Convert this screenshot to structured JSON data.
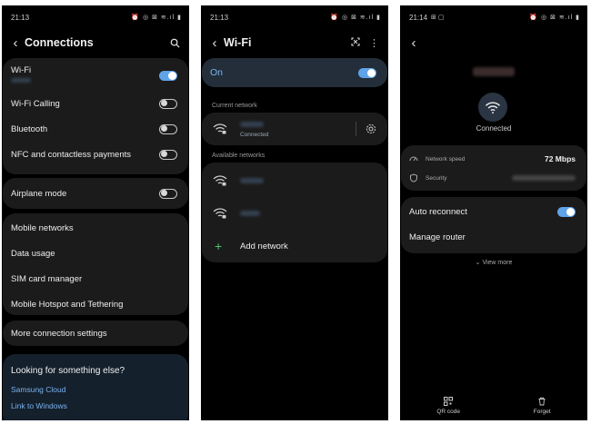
{
  "screen1": {
    "status": {
      "time": "21:13",
      "icons": "⏰ ◎ ⊠ ≋.ıl ▮"
    },
    "title": "Connections",
    "items": {
      "wifi": "Wi-Fi",
      "wifi_calling": "Wi-Fi Calling",
      "bluetooth": "Bluetooth",
      "nfc": "NFC and contactless payments",
      "airplane": "Airplane mode",
      "mobile_networks": "Mobile networks",
      "data_usage": "Data usage",
      "sim_manager": "SIM card manager",
      "hotspot": "Mobile Hotspot and Tethering",
      "more_settings": "More connection settings"
    },
    "suggest": {
      "heading": "Looking for something else?",
      "links": [
        "Samsung Cloud",
        "Link to Windows"
      ]
    },
    "toggles": {
      "wifi": true,
      "wifi_calling": false,
      "bluetooth": false,
      "nfc": false,
      "airplane": false
    }
  },
  "screen2": {
    "status": {
      "time": "21:13",
      "icons": "⏰ ◎ ⊠ ≋.ıl ▮"
    },
    "title": "Wi-Fi",
    "on_label": "On",
    "current_label": "Current network",
    "current_status": "Connected",
    "available_label": "Available networks",
    "add_network": "Add network"
  },
  "screen3": {
    "status": {
      "time": "21:14",
      "icons": "⏰ ◎ ⊠ ≋.ıl ▮"
    },
    "connected": "Connected",
    "network_speed_label": "Network speed",
    "network_speed_value": "72 Mbps",
    "security_label": "Security",
    "auto_reconnect": "Auto reconnect",
    "manage_router": "Manage router",
    "view_more": "View more",
    "qr_code": "QR code",
    "forget": "Forget"
  },
  "colors": {
    "accent": "#5fa3e8",
    "card": "#1b1b1b",
    "link": "#7ab3f0"
  }
}
